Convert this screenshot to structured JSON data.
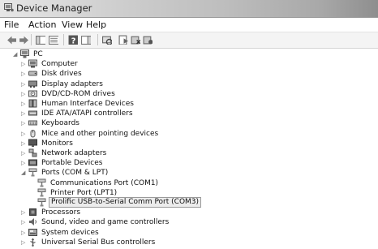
{
  "window": {
    "title": "Device Manager"
  },
  "menu": [
    "File",
    "Action",
    "View",
    "Help"
  ],
  "toolbar": [
    {
      "icon": "back-arrow-icon",
      "name": "back-button"
    },
    {
      "icon": "forward-arrow-icon",
      "name": "forward-button"
    },
    {
      "icon": "show-hide-console-tree-icon",
      "name": "console-tree-button"
    },
    {
      "icon": "properties-icon",
      "name": "properties-button"
    },
    {
      "icon": "help-icon",
      "name": "help-button"
    },
    {
      "icon": "action-pane-icon",
      "name": "action-pane-button"
    },
    {
      "icon": "scan-hardware-icon",
      "name": "scan-hardware-button"
    },
    {
      "icon": "update-driver-icon",
      "name": "update-driver-button"
    },
    {
      "icon": "uninstall-icon",
      "name": "uninstall-button"
    },
    {
      "icon": "enable-device-icon",
      "name": "enable-button"
    }
  ],
  "tree": {
    "root": "PC",
    "categories": [
      {
        "label": "Computer",
        "icon": "computer-icon",
        "expanded": false
      },
      {
        "label": "Disk drives",
        "icon": "disk-drive-icon",
        "expanded": false
      },
      {
        "label": "Display adapters",
        "icon": "display-adapter-icon",
        "expanded": false
      },
      {
        "label": "DVD/CD-ROM drives",
        "icon": "dvd-drive-icon",
        "expanded": false
      },
      {
        "label": "Human Interface Devices",
        "icon": "hid-icon",
        "expanded": false
      },
      {
        "label": "IDE ATA/ATAPI controllers",
        "icon": "ide-controller-icon",
        "expanded": false
      },
      {
        "label": "Keyboards",
        "icon": "keyboard-icon",
        "expanded": false
      },
      {
        "label": "Mice and other pointing devices",
        "icon": "mouse-icon",
        "expanded": false
      },
      {
        "label": "Monitors",
        "icon": "monitor-icon",
        "expanded": false
      },
      {
        "label": "Network adapters",
        "icon": "network-adapter-icon",
        "expanded": false
      },
      {
        "label": "Portable Devices",
        "icon": "portable-device-icon",
        "expanded": false
      },
      {
        "label": "Ports (COM & LPT)",
        "icon": "port-icon",
        "expanded": true,
        "children": [
          {
            "label": "Communications Port (COM1)",
            "icon": "port-icon"
          },
          {
            "label": "Printer Port (LPT1)",
            "icon": "port-icon"
          },
          {
            "label": "Prolific USB-to-Serial Comm Port (COM3)",
            "icon": "port-icon",
            "selected": true
          }
        ]
      },
      {
        "label": "Processors",
        "icon": "processor-icon",
        "expanded": false
      },
      {
        "label": "Sound, video and game controllers",
        "icon": "sound-icon",
        "expanded": false
      },
      {
        "label": "System devices",
        "icon": "system-device-icon",
        "expanded": false
      },
      {
        "label": "Universal Serial Bus controllers",
        "icon": "usb-icon",
        "expanded": false
      }
    ]
  }
}
